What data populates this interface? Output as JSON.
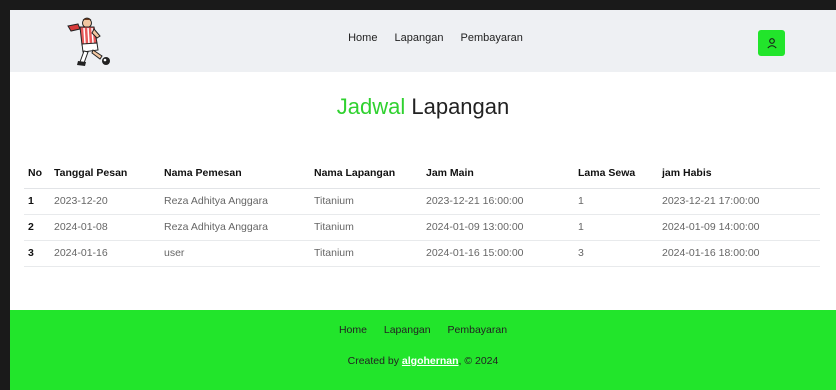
{
  "nav": {
    "links": [
      "Home",
      "Lapangan",
      "Pembayaran"
    ],
    "user_icon": "user-icon"
  },
  "title": {
    "accent": "Jadwal",
    "rest": "Lapangan"
  },
  "table": {
    "headers": [
      "No",
      "Tanggal Pesan",
      "Nama Pemesan",
      "Nama Lapangan",
      "Jam Main",
      "Lama Sewa",
      "jam Habis"
    ],
    "rows": [
      [
        "1",
        "2023-12-20",
        "Reza Adhitya Anggara",
        "Titanium",
        "2023-12-21 16:00:00",
        "1",
        "2023-12-21 17:00:00"
      ],
      [
        "2",
        "2024-01-08",
        "Reza Adhitya Anggara",
        "Titanium",
        "2024-01-09 13:00:00",
        "1",
        "2024-01-09 14:00:00"
      ],
      [
        "3",
        "2024-01-16",
        "user",
        "Titanium",
        "2024-01-16 15:00:00",
        "3",
        "2024-01-16 18:00:00"
      ]
    ]
  },
  "footer": {
    "links": [
      "Home",
      "Lapangan",
      "Pembayaran"
    ],
    "credit_prefix": "Created by",
    "credit_author": "algohernan",
    "credit_suffix": ", © 2024"
  },
  "colors": {
    "accent": "#22e52b",
    "title_accent": "#2fd12f",
    "navbar": "#eef0f3"
  }
}
